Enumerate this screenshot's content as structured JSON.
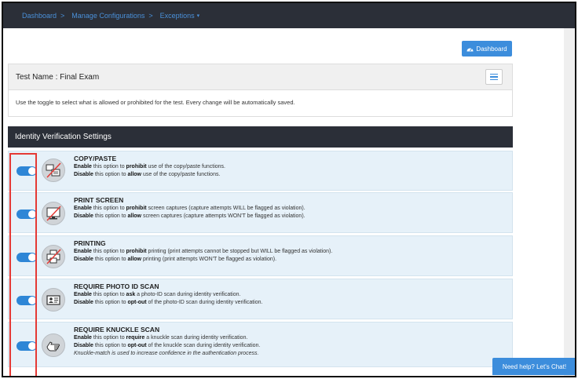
{
  "navbar": {
    "items": [
      {
        "label": "Dashboard",
        "sep": ">"
      },
      {
        "label": "Manage Configurations",
        "sep": ">"
      },
      {
        "label": "Exceptions",
        "caret": "▾"
      }
    ]
  },
  "toolbar": {
    "dashboard_label": "Dashboard",
    "dashboard_icon": "dashboard-gauge-icon"
  },
  "test": {
    "title": "Test Name : Final Exam",
    "description": "Use the toggle to select what is allowed or prohibited for the test. Every change will be automatically saved."
  },
  "section": {
    "title": "Identity Verification Settings"
  },
  "settings": [
    {
      "title": "COPY/PASTE",
      "line1": {
        "pre": "Enable",
        "mid": " this option to ",
        "key": "prohibit",
        "post": " use of the copy/paste functions."
      },
      "line2": {
        "pre": "Disable",
        "mid": " this option to ",
        "key": "allow",
        "post": " use of the copy/paste functions."
      },
      "icon": "copy-paste-prohibited-icon",
      "enabled": true
    },
    {
      "title": "PRINT SCREEN",
      "line1": {
        "pre": "Enable",
        "mid": " this option to ",
        "key": "prohibit",
        "post": " screen captures (capture attempts WILL be flagged as violation)."
      },
      "line2": {
        "pre": "Disable",
        "mid": " this option to ",
        "key": "allow",
        "post": " screen captures (capture attempts WON'T be flagged as violation)."
      },
      "icon": "print-screen-prohibited-icon",
      "enabled": true
    },
    {
      "title": "PRINTING",
      "line1": {
        "pre": "Enable",
        "mid": " this option to ",
        "key": "prohibit",
        "post": " printing (print attempts cannot be stopped but WILL be flagged as violation)."
      },
      "line2": {
        "pre": "Disable",
        "mid": " this option to ",
        "key": "allow",
        "post": " printing (print attempts WON'T be flagged as violation)."
      },
      "icon": "printer-prohibited-icon",
      "enabled": true
    },
    {
      "title": "REQUIRE PHOTO ID SCAN",
      "line1": {
        "pre": "Enable",
        "mid": " this option to ",
        "key": "ask",
        "post": " a photo-ID scan during identity verification."
      },
      "line2": {
        "pre": "Disable",
        "mid": " this option to ",
        "key": "opt-out",
        "post": " of the photo-ID scan during identity verification."
      },
      "icon": "id-card-icon",
      "enabled": true
    },
    {
      "title": "REQUIRE KNUCKLE SCAN",
      "line1": {
        "pre": "Enable",
        "mid": " this option to ",
        "key": "require",
        "post": " a knuckle scan during identity verification."
      },
      "line2": {
        "pre": "Disable",
        "mid": " this option to ",
        "key": "opt-out",
        "post": " of the knuckle scan during identity verification."
      },
      "note": "Knuckle-match is used to increase confidence in the authentication process.",
      "icon": "hand-knuckle-icon",
      "enabled": true
    }
  ],
  "chat": {
    "label": "Need help? Let's Chat!"
  },
  "colors": {
    "accent": "#3c8ddc",
    "navbar": "#2b2f38",
    "row_bg": "#e6f1f9",
    "highlight": "#e53935"
  }
}
